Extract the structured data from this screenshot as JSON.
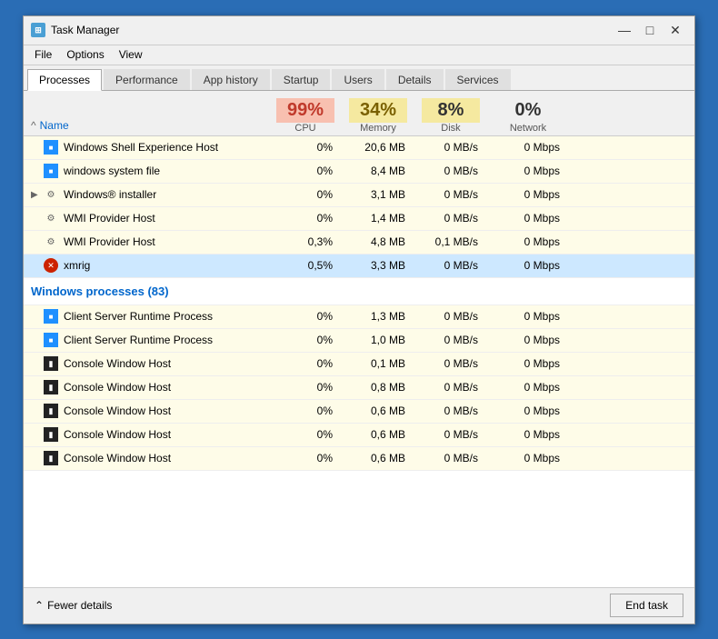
{
  "window": {
    "title": "Task Manager",
    "icon": "TM"
  },
  "menu": {
    "items": [
      "File",
      "Options",
      "View"
    ]
  },
  "tabs": [
    {
      "label": "Processes",
      "active": true
    },
    {
      "label": "Performance",
      "active": false
    },
    {
      "label": "App history",
      "active": false
    },
    {
      "label": "Startup",
      "active": false
    },
    {
      "label": "Users",
      "active": false
    },
    {
      "label": "Details",
      "active": false
    },
    {
      "label": "Services",
      "active": false
    }
  ],
  "columns": {
    "sort_arrow": "^",
    "name": "Name",
    "cpu": {
      "percent": "99%",
      "label": "CPU"
    },
    "memory": {
      "percent": "34%",
      "label": "Memory"
    },
    "disk": {
      "percent": "8%",
      "label": "Disk"
    },
    "network": {
      "percent": "0%",
      "label": "Network"
    }
  },
  "processes": [
    {
      "name": "Windows Shell Experience Host",
      "icon": "blue",
      "cpu": "0%",
      "mem": "20,6 MB",
      "disk": "0 MB/s",
      "net": "0 Mbps",
      "bg": "yellow"
    },
    {
      "name": "windows system file",
      "icon": "blue",
      "cpu": "0%",
      "mem": "8,4 MB",
      "disk": "0 MB/s",
      "net": "0 Mbps",
      "bg": "yellow"
    },
    {
      "name": "Windows® installer",
      "icon": "gear",
      "cpu": "0%",
      "mem": "3,1 MB",
      "disk": "0 MB/s",
      "net": "0 Mbps",
      "bg": "yellow",
      "expandable": true
    },
    {
      "name": "WMI Provider Host",
      "icon": "gear",
      "cpu": "0%",
      "mem": "1,4 MB",
      "disk": "0 MB/s",
      "net": "0 Mbps",
      "bg": "yellow"
    },
    {
      "name": "WMI Provider Host",
      "icon": "gear",
      "cpu": "0,3%",
      "mem": "4,8 MB",
      "disk": "0,1 MB/s",
      "net": "0 Mbps",
      "bg": "yellow"
    },
    {
      "name": "xmrig",
      "icon": "xmrig",
      "cpu": "0,5%",
      "mem": "3,3 MB",
      "disk": "0 MB/s",
      "net": "0 Mbps",
      "bg": "blue",
      "highlighted": true
    }
  ],
  "windows_processes_header": "Windows processes (83)",
  "windows_processes": [
    {
      "name": "Client Server Runtime Process",
      "icon": "blue",
      "cpu": "0%",
      "mem": "1,3 MB",
      "disk": "0 MB/s",
      "net": "0 Mbps",
      "bg": "yellow"
    },
    {
      "name": "Client Server Runtime Process",
      "icon": "blue",
      "cpu": "0%",
      "mem": "1,0 MB",
      "disk": "0 MB/s",
      "net": "0 Mbps",
      "bg": "yellow"
    },
    {
      "name": "Console Window Host",
      "icon": "terminal",
      "cpu": "0%",
      "mem": "0,1 MB",
      "disk": "0 MB/s",
      "net": "0 Mbps",
      "bg": "yellow"
    },
    {
      "name": "Console Window Host",
      "icon": "terminal",
      "cpu": "0%",
      "mem": "0,8 MB",
      "disk": "0 MB/s",
      "net": "0 Mbps",
      "bg": "yellow"
    },
    {
      "name": "Console Window Host",
      "icon": "terminal",
      "cpu": "0%",
      "mem": "0,6 MB",
      "disk": "0 MB/s",
      "net": "0 Mbps",
      "bg": "yellow"
    },
    {
      "name": "Console Window Host",
      "icon": "terminal",
      "cpu": "0%",
      "mem": "0,6 MB",
      "disk": "0 MB/s",
      "net": "0 Mbps",
      "bg": "yellow"
    },
    {
      "name": "Console Window Host",
      "icon": "terminal",
      "cpu": "0%",
      "mem": "0,6 MB",
      "disk": "0 MB/s",
      "net": "0 Mbps",
      "bg": "yellow"
    }
  ],
  "footer": {
    "fewer_details": "Fewer details",
    "end_task": "End task"
  }
}
